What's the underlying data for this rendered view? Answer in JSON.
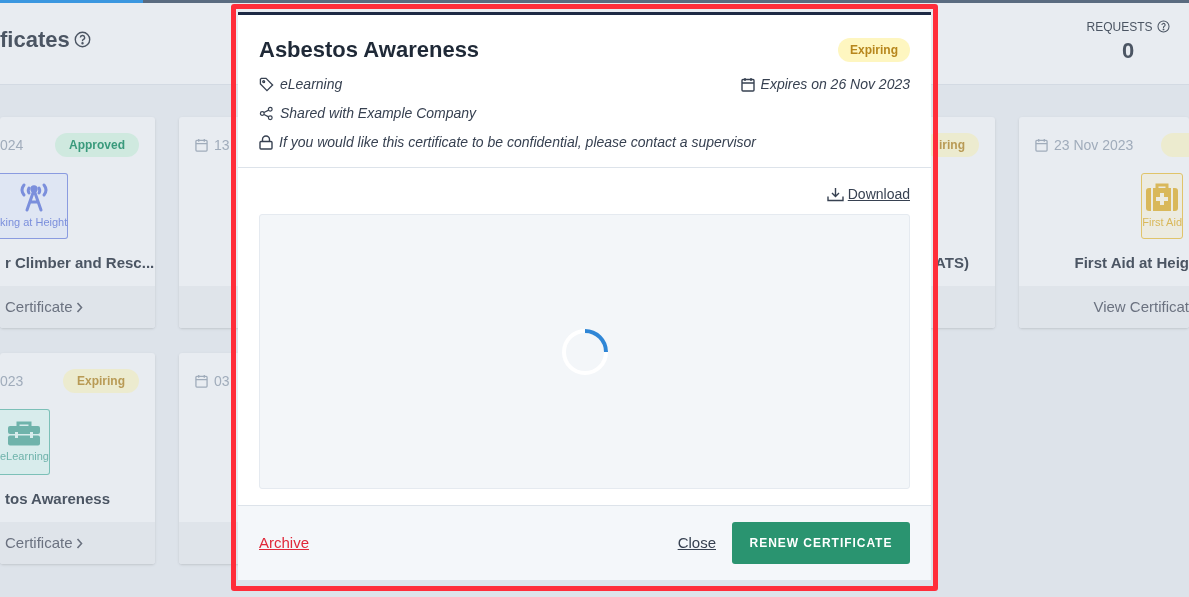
{
  "top_progress": {
    "level": 0.12
  },
  "page": {
    "title": "ficates",
    "requests_label": "REQUESTS",
    "requests_value": "0"
  },
  "card_rows": [
    [
      {
        "date": "024",
        "status": {
          "label": "Approved",
          "kind": "approved"
        },
        "icon": {
          "kind": "height",
          "label": "king at Height"
        },
        "title": "r Climber and Resc...",
        "link": "Certificate",
        "chevron": true
      },
      {
        "date": "13"
      },
      {
        "status": {
          "label": "iring",
          "kind": "expiring"
        },
        "title": "ATS)"
      },
      {
        "date": "23 Nov 2023",
        "status": {
          "kind": "expiring"
        },
        "icon": {
          "kind": "firstaid",
          "label": "First Aid"
        },
        "title": "First Aid at Heig",
        "link": "View Certificat",
        "chevron": false
      }
    ],
    [
      {
        "date": "023",
        "status": {
          "label": "Expiring",
          "kind": "expiring"
        },
        "icon": {
          "kind": "elearning",
          "label": "eLearning"
        },
        "title": "tos Awareness",
        "link": "Certificate",
        "chevron": true
      },
      {
        "date": "03"
      }
    ]
  ],
  "dialog": {
    "title": "Asbestos Awareness",
    "status": {
      "label": "Expiring",
      "kind": "expiring"
    },
    "category": "eLearning",
    "expiry": "Expires on 26 Nov 2023",
    "shared": "Shared with Example Company",
    "confidential_note": "If you would like this certificate to be confidential, please contact a supervisor",
    "download": "Download",
    "archive": "Archive",
    "close": "Close",
    "renew": "RENEW CERTIFICATE"
  }
}
